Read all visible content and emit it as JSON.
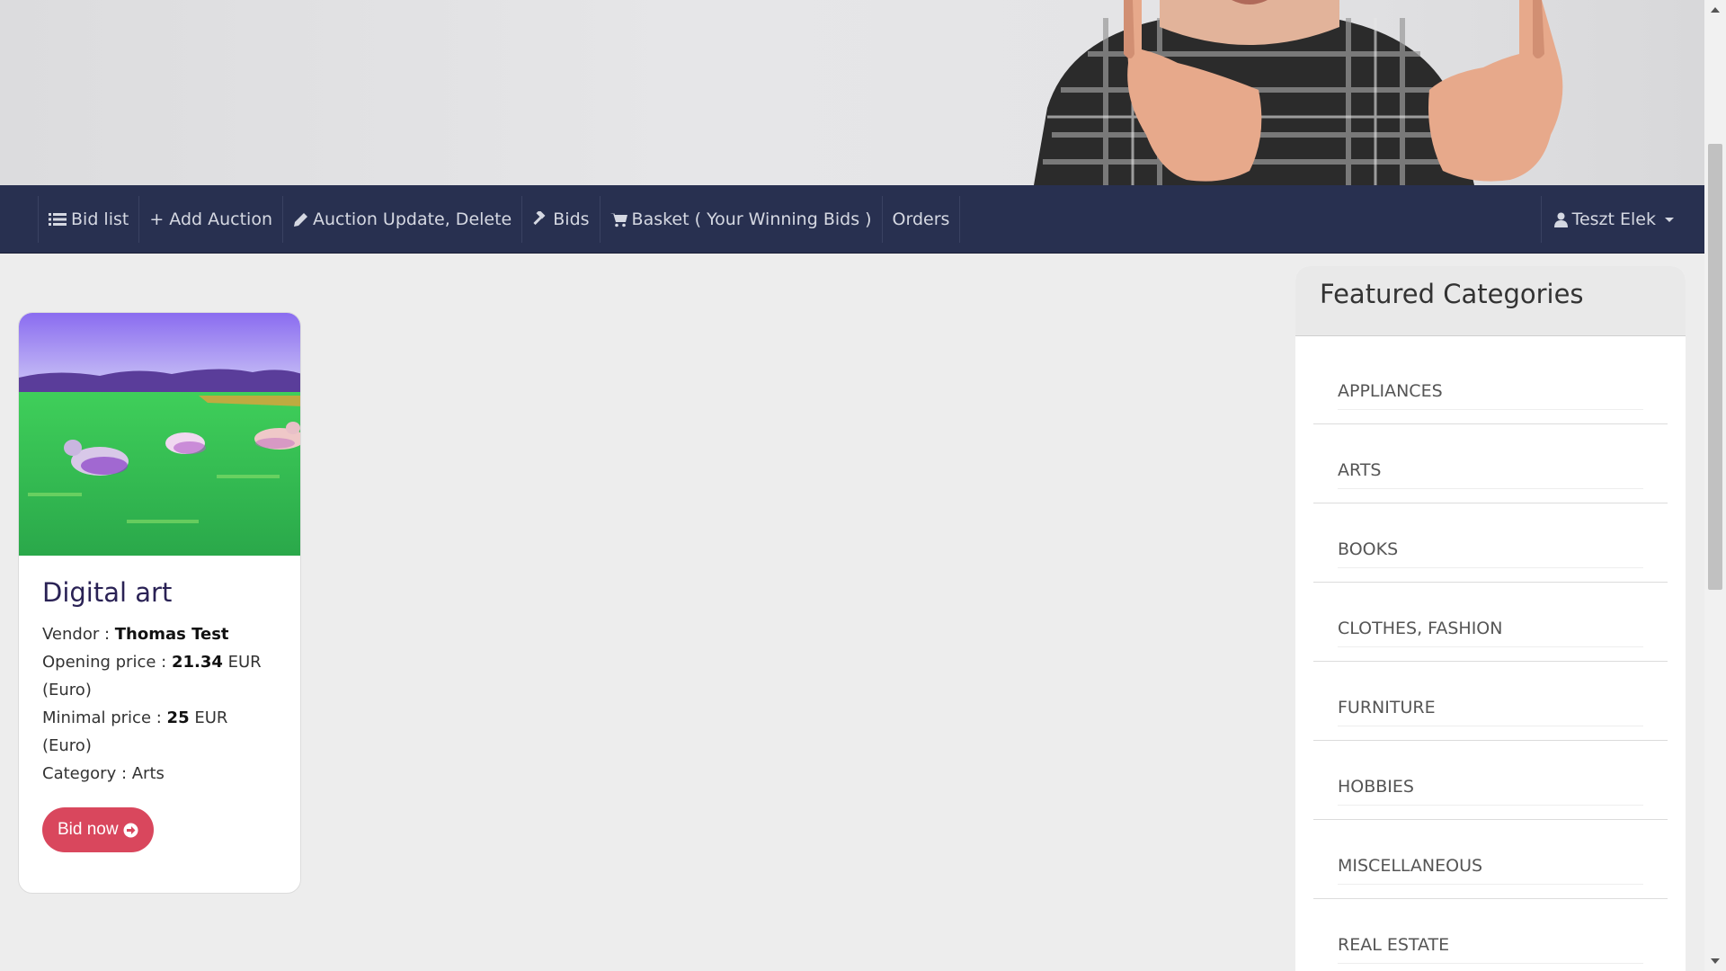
{
  "nav": {
    "items": [
      {
        "label": "Bid list",
        "icon": "list-icon"
      },
      {
        "label": "+ Add Auction",
        "icon": ""
      },
      {
        "label": "Auction Update, Delete",
        "icon": "pencil-icon"
      },
      {
        "label": "Bids",
        "icon": "gavel-icon"
      },
      {
        "label": "Basket ( Your Winning Bids )",
        "icon": "cart-icon"
      },
      {
        "label": "Orders",
        "icon": ""
      }
    ],
    "user": {
      "label": "Teszt Elek",
      "icon": "user-icon"
    }
  },
  "card": {
    "title": "Digital art",
    "vendor_label": "Vendor : ",
    "vendor": "Thomas Test",
    "opening_label": "Opening price : ",
    "opening_value": "21.34",
    "opening_currency": " EUR (Euro)",
    "minimal_label": "Minimal price : ",
    "minimal_value": "25",
    "minimal_currency": " EUR (Euro)",
    "category_line": "Category : Arts",
    "button_label": "Bid now"
  },
  "featured": {
    "title": "Featured Categories",
    "items": [
      "APPLIANCES",
      "ARTS",
      "BOOKS",
      "CLOTHES, FASHION",
      "FURNITURE",
      "HOBBIES",
      "MISCELLANEOUS",
      "REAL ESTATE"
    ]
  },
  "colors": {
    "navbar": "#283050",
    "button": "#d9475d",
    "card_title": "#2a2255"
  }
}
